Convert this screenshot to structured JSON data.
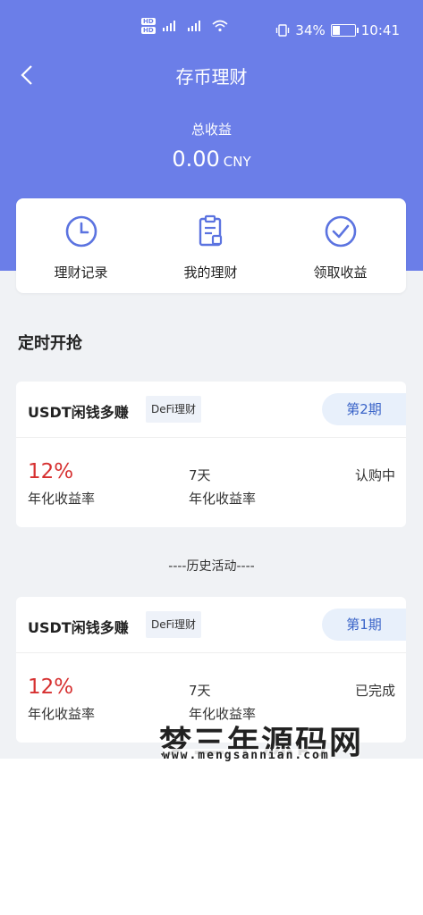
{
  "status_bar": {
    "sim1": "HD",
    "sim2": "HD",
    "network": "4G",
    "battery": "34%",
    "time": "10:41"
  },
  "header": {
    "title": "存币理财",
    "total_earnings_label": "总收益",
    "total_earnings_value": "0.00",
    "currency": "CNY"
  },
  "menu": {
    "items": [
      {
        "label": "理财记录",
        "icon": "clock-icon"
      },
      {
        "label": "我的理财",
        "icon": "clipboard-icon"
      },
      {
        "label": "领取收益",
        "icon": "check-circle-icon"
      }
    ]
  },
  "section": {
    "title": "定时开抢"
  },
  "products": [
    {
      "name": "USDT闲钱多赚",
      "tag": "DeFi理财",
      "period": "第2期",
      "rate": "12%",
      "rate_label": "年化收益率",
      "days": "7天",
      "days_label": "年化收益率",
      "state": "认购中"
    },
    {
      "name": "USDT闲钱多赚",
      "tag": "DeFi理财",
      "period": "第1期",
      "rate": "12%",
      "rate_label": "年化收益率",
      "days": "7天",
      "days_label": "年化收益率",
      "state": "已完成"
    }
  ],
  "history_label": "----历史活动----",
  "watermark": {
    "title": "梦三年源码网",
    "url": "www.mengsannian.com"
  },
  "colors": {
    "header_bg": "#6b7ee8",
    "accent": "#5b73e0",
    "rate": "#d63030",
    "period_text": "#3a64c8"
  }
}
